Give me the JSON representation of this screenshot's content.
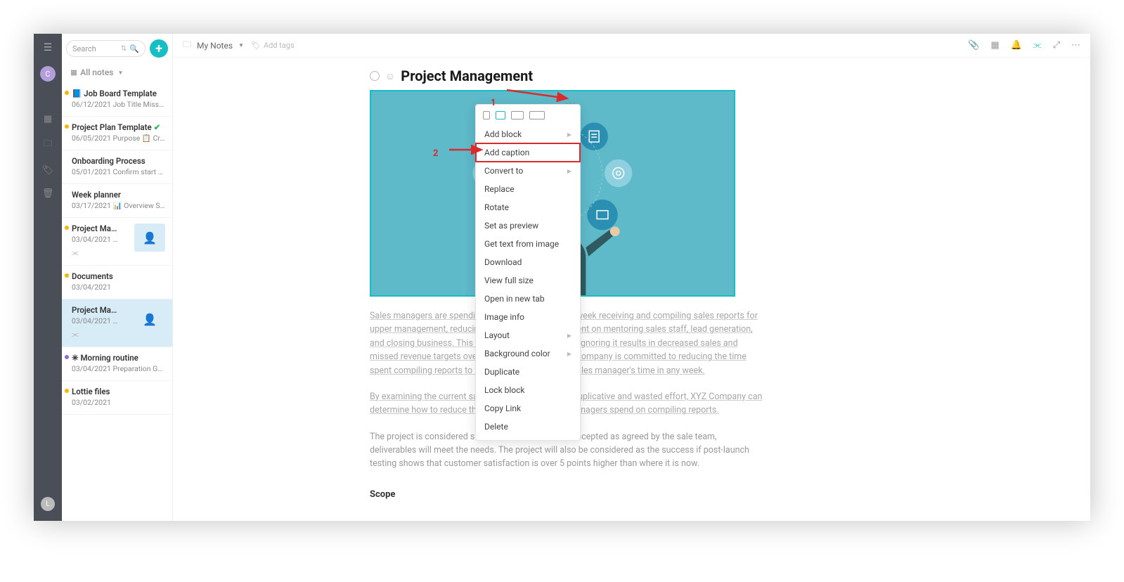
{
  "rail": {
    "avatar_letter": "C",
    "bottom_letter": "L"
  },
  "sidebar": {
    "search_placeholder": "Search",
    "all_notes_label": "All notes",
    "items": [
      {
        "dot": "#f5b800",
        "icon": "📘",
        "title": "Job Board Template",
        "sub": "06/12/2021 Job Title Missi…"
      },
      {
        "dot": "#f5b800",
        "title": "Project Plan Template",
        "check": true,
        "sub": "06/05/2021 Purpose 📋 Cr…"
      },
      {
        "title": "Onboarding Process",
        "sub": "05/01/2021 Confirm start …"
      },
      {
        "title": "Week planner",
        "sub": "03/17/2021 📊 Overview S…"
      },
      {
        "dot": "#f5b800",
        "title": "Project Ma…",
        "sub": "03/04/2021 …",
        "thumb": true,
        "share": true
      },
      {
        "dot": "#f5b800",
        "title": "Documents",
        "sub": "03/04/2021"
      },
      {
        "title": "Project Ma…",
        "sub": "03/04/2021 …",
        "thumb": true,
        "share": true,
        "selected": true
      },
      {
        "dot": "#8e6dcf",
        "icon": "✳",
        "title": "Morning routine",
        "sub": "03/04/2021 Preparation G…"
      },
      {
        "dot": "#f5b800",
        "title": "Lottie files",
        "sub": "03/02/2021"
      }
    ]
  },
  "topbar": {
    "breadcrumb": "My Notes",
    "add_tags": "Add tags"
  },
  "page": {
    "title": "Project Management",
    "para1": "Sales managers are spending 20% of their time each week receiving and compiling sales reports for upper management, reducing the number of hours spent on mentoring sales staff, lead generation, and closing business. This is a productivity issue and ignoring it results in decreased sales and missed revenue targets over the past 3 months. XYZ Company is committed to reducing the time spent compiling reports to no more than 10% of the sales manager's time in any week.",
    "para2": "By examining the current sales report processes for duplicative and wasted effort, XYZ Company can determine how to reduce the amount of time sales managers spend on compiling reports.",
    "para3": "The project is considered successful when it will be accepted as agreed by the sale team, deliverables will meet the needs. The project will also be considered as the success if post-launch testing shows that customer satisfaction is over 5 points higher than where it is now.",
    "scope_head": "Scope"
  },
  "context_menu": {
    "items": [
      {
        "label": "Add block",
        "sub": true
      },
      {
        "label": "Add caption",
        "highlight": true
      },
      {
        "label": "Convert to",
        "sub": true
      },
      {
        "label": "Replace"
      },
      {
        "label": "Rotate"
      },
      {
        "label": "Set as preview"
      },
      {
        "label": "Get text from image"
      },
      {
        "label": "Download"
      },
      {
        "label": "View full size"
      },
      {
        "label": "Open in new tab"
      },
      {
        "label": "Image info"
      },
      {
        "label": "Layout",
        "sub": true
      },
      {
        "label": "Background color",
        "sub": true
      },
      {
        "label": "Duplicate"
      },
      {
        "label": "Lock block"
      },
      {
        "label": "Copy Link"
      },
      {
        "label": "Delete"
      }
    ]
  },
  "annotations": {
    "one": "1",
    "two": "2"
  }
}
